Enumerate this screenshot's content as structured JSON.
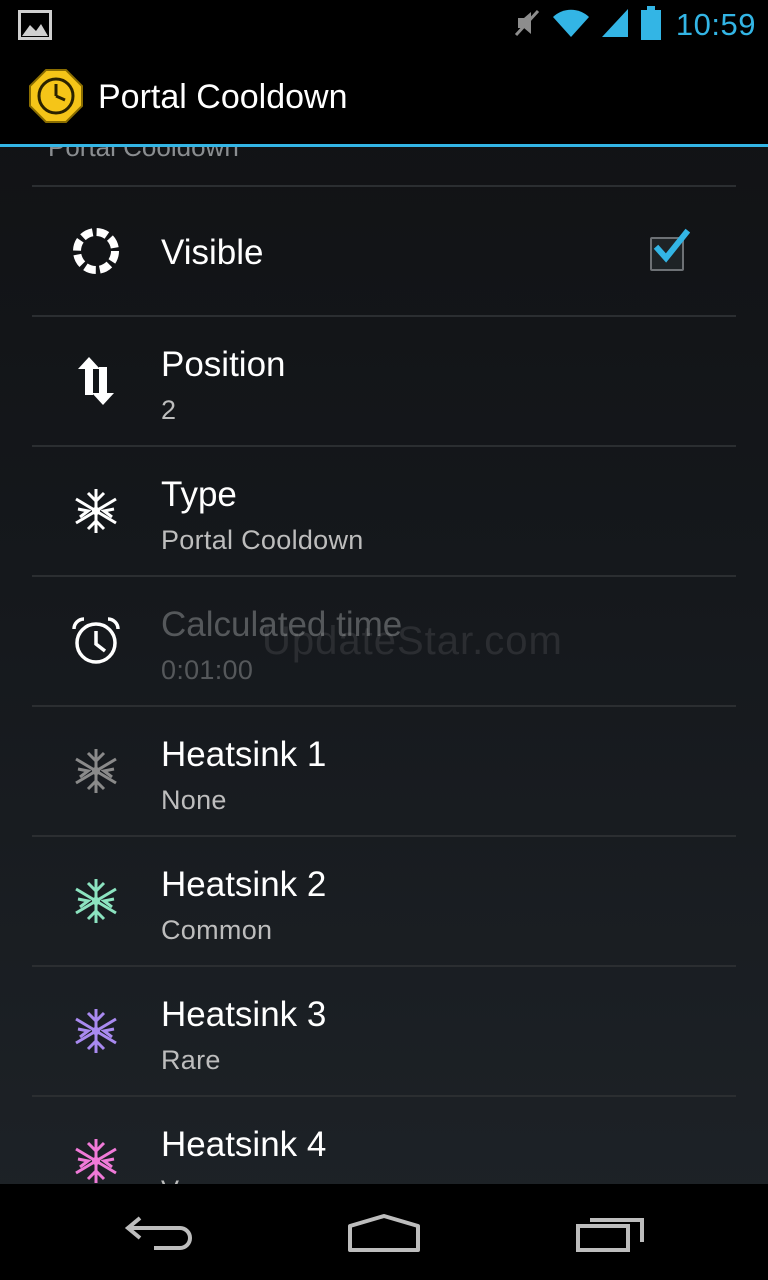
{
  "status_bar": {
    "time": "10:59",
    "icons": [
      "image-notification-icon",
      "muted-icon",
      "wifi-icon",
      "signal-icon",
      "battery-icon"
    ],
    "accent_color": "#33b5e5"
  },
  "action_bar": {
    "title": "Portal Cooldown",
    "icon": "portal-cooldown-app-icon"
  },
  "settings": {
    "category_header": "Portal Cooldown",
    "items": [
      {
        "title": "Visible",
        "summary": "",
        "icon": "portal-ring-icon",
        "checked": true
      },
      {
        "title": "Position",
        "summary": "2",
        "icon": "sort-arrows-icon"
      },
      {
        "title": "Type",
        "summary": "Portal Cooldown",
        "icon": "heatsink-white-icon"
      },
      {
        "title": "Calculated time",
        "summary": "0:01:00",
        "icon": "alarm-clock-icon",
        "enabled": false
      },
      {
        "title": "Heatsink 1",
        "summary": "None",
        "icon": "heatsink-gray-icon",
        "color": "#8a8a8a"
      },
      {
        "title": "Heatsink 2",
        "summary": "Common",
        "icon": "heatsink-green-icon",
        "color": "#8ce3c0"
      },
      {
        "title": "Heatsink 3",
        "summary": "Rare",
        "icon": "heatsink-purple-icon",
        "color": "#a98af0"
      },
      {
        "title": "Heatsink 4",
        "summary": "Very rare",
        "icon": "heatsink-pink-icon",
        "color": "#f07ad8"
      }
    ]
  },
  "watermark": "UpdateStar.com",
  "nav_bar": {
    "buttons": [
      "back-icon",
      "home-icon",
      "recents-icon"
    ]
  }
}
